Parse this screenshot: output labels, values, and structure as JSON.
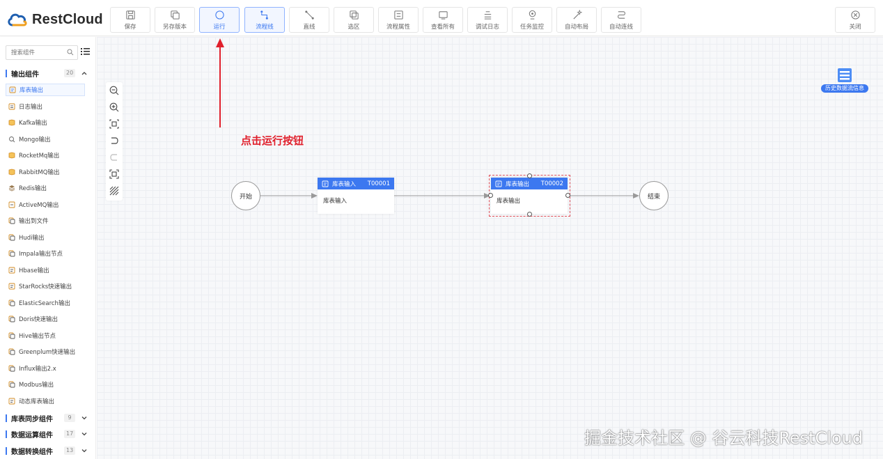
{
  "app": {
    "brand": "RestCloud",
    "brand_color": "#3c78f0",
    "accent_red": "#e0202c"
  },
  "toolbar": {
    "save": "保存",
    "save_as": "另存版本",
    "run": "运行",
    "flow_line": "流程线",
    "straight_line": "直线",
    "select_area": "选区",
    "flow_props": "流程属性",
    "view_all": "查看所有",
    "debug_log": "调试日志",
    "task_monitor": "任务监控",
    "auto_layout": "自动布局",
    "auto_connect": "自动连线",
    "close": "关闭"
  },
  "sidebar": {
    "search_placeholder": "搜索组件",
    "groups": [
      {
        "title": "输出组件",
        "count": "20"
      },
      {
        "title": "库表同步组件",
        "count": "9"
      },
      {
        "title": "数据运算组件",
        "count": "17"
      },
      {
        "title": "数据转换组件",
        "count": "13"
      }
    ],
    "items": [
      "库表输出",
      "日志输出",
      "Kafka输出",
      "Mongo输出",
      "RocketMq输出",
      "RabbitMQ输出",
      "Redis输出",
      "ActiveMQ输出",
      "输出到文件",
      "Hudi输出",
      "Impala输出节点",
      "Hbase输出",
      "StarRocks快速输出",
      "ElasticSearch输出",
      "Doris快速输出",
      "Hive输出节点",
      "Greenplum快速输出",
      "Influx输出2.x",
      "Modbus输出",
      "动态库表输出"
    ]
  },
  "canvas": {
    "history_label": "历史数据流信息",
    "annotation": "点击运行按钮",
    "start_node": "开始",
    "end_node": "结束",
    "node1": {
      "name": "库表输入",
      "code": "T00001",
      "body": "库表输入"
    },
    "node2": {
      "name": "库表输出",
      "code": "T00002",
      "body": "库表输出"
    }
  },
  "watermark": "掘金技术社区 @ 谷云科技RestCloud"
}
